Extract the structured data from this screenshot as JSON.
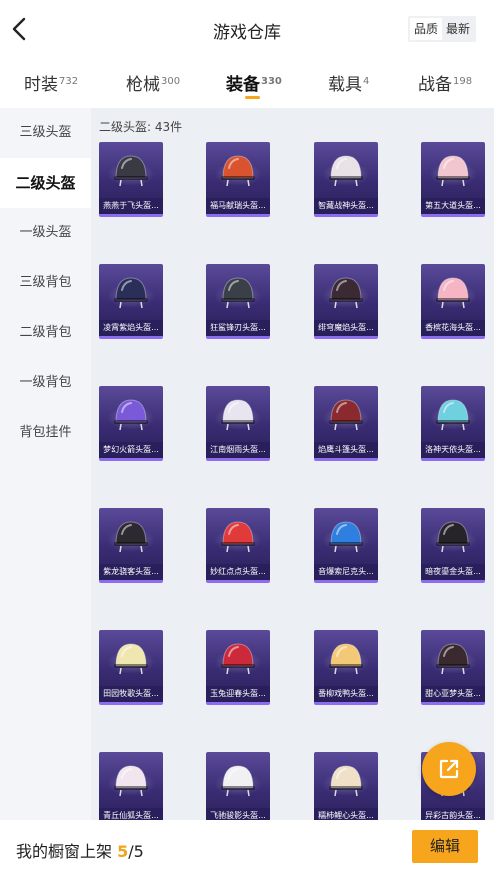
{
  "header": {
    "title": "游戏仓库",
    "back_icon": "chevron-left-icon",
    "sort_options": [
      "品质",
      "最新"
    ],
    "sort_selected": "品质"
  },
  "tabs": [
    {
      "label": "时装",
      "count": "732"
    },
    {
      "label": "枪械",
      "count": "300"
    },
    {
      "label": "装备",
      "count": "330"
    },
    {
      "label": "载具",
      "count": "4"
    },
    {
      "label": "战备",
      "count": "198"
    }
  ],
  "active_tab": "装备",
  "sidebar": {
    "items": [
      "三级头盔",
      "二级头盔",
      "一级头盔",
      "三级背包",
      "二级背包",
      "一级背包",
      "背包挂件"
    ],
    "active": "二级头盔"
  },
  "content": {
    "count_label": "二级头盔: 43件",
    "items": [
      {
        "name": "燕燕于飞头盔...",
        "color": "#3a3a44"
      },
      {
        "name": "福马献瑞头盔...",
        "color": "#d9532f"
      },
      {
        "name": "智藏战神头盔...",
        "color": "#e8e2e6"
      },
      {
        "name": "第五大道头盔...",
        "color": "#f2c6cf"
      },
      {
        "name": "凌霄紫焰头盔...",
        "color": "#2a2f5a"
      },
      {
        "name": "狂鲨锋刃头盔...",
        "color": "#3b4048"
      },
      {
        "name": "绯穹魔焰头盔...",
        "color": "#3b2a34"
      },
      {
        "name": "香槟花海头盔...",
        "color": "#f5b5c5"
      },
      {
        "name": "梦幻火箭头盔...",
        "color": "#7a5ad8"
      },
      {
        "name": "江南烟雨头盔...",
        "color": "#e8e4f0"
      },
      {
        "name": "焰鹰斗篷头盔...",
        "color": "#8a2a2e"
      },
      {
        "name": "洛神天依头盔...",
        "color": "#6fd0e0"
      },
      {
        "name": "紫龙骁客头盔...",
        "color": "#2c2a30"
      },
      {
        "name": "妙红点点头盔...",
        "color": "#e03a3a"
      },
      {
        "name": "音爆索尼克头...",
        "color": "#2f7fe0"
      },
      {
        "name": "暗夜鎏金头盔...",
        "color": "#262428"
      },
      {
        "name": "田园牧歌头盔...",
        "color": "#efe6b0"
      },
      {
        "name": "玉兔迎春头盔...",
        "color": "#cc2a3a"
      },
      {
        "name": "番柳戏鸭头盔...",
        "color": "#f3c978"
      },
      {
        "name": "甜心亚梦头盔...",
        "color": "#3a2a30"
      },
      {
        "name": "青丘仙狐头盔...",
        "color": "#f2e6ee"
      },
      {
        "name": "飞驰骏影头盔...",
        "color": "#f1f1f4"
      },
      {
        "name": "糯柿鲤心头盔...",
        "color": "#f0e0c8"
      },
      {
        "name": "异彩古韵头盔...",
        "color": "#c89a5a"
      }
    ]
  },
  "fab": {
    "icon": "share-external-icon"
  },
  "bottom": {
    "shelf_label": "我的橱窗上架",
    "shelf_current": "5",
    "shelf_total": "/5",
    "edit_label": "编辑"
  },
  "colors": {
    "accent": "#f7a51c",
    "card_top": "#5a4a99",
    "card_bottom": "#2a205a"
  }
}
